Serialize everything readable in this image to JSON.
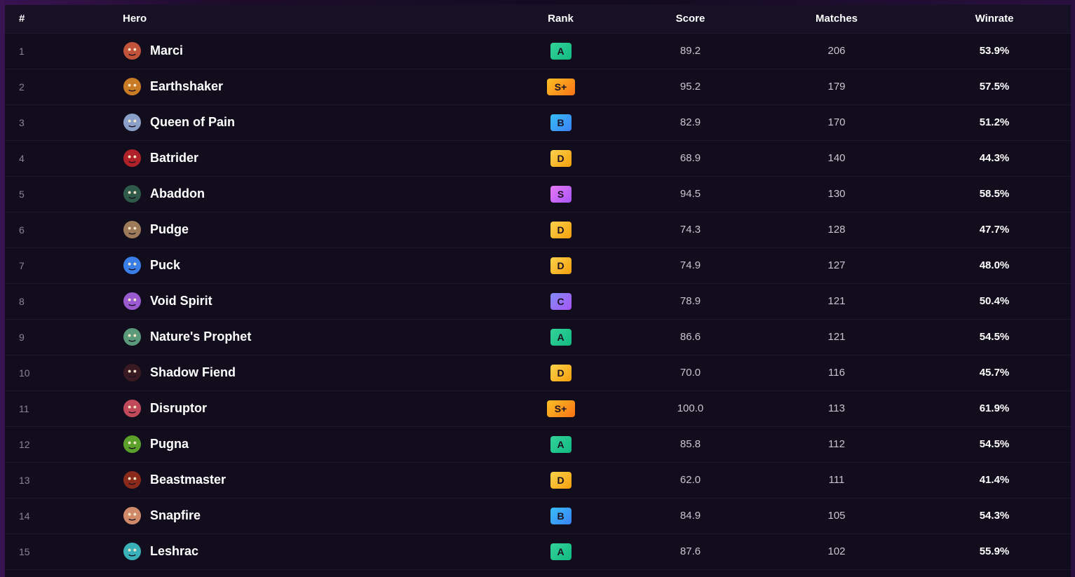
{
  "headers": {
    "num": "#",
    "hero": "Hero",
    "rank": "Rank",
    "score": "Score",
    "matches": "Matches",
    "winrate": "Winrate"
  },
  "rank_colors": {
    "A": "#10b981",
    "S+": "#f59e0b",
    "B": "#3b82f6",
    "C": "#a855f7",
    "D": "#fbbf24",
    "S": "#d946ef"
  },
  "rows": [
    {
      "num": "1",
      "hero": "Marci",
      "icon": "marci-portrait-icon",
      "icon_color": "#c0533a",
      "rank": "A",
      "score": "89.2",
      "matches": "206",
      "winrate": "53.9%"
    },
    {
      "num": "2",
      "hero": "Earthshaker",
      "icon": "earthshaker-portrait-icon",
      "icon_color": "#c97a25",
      "rank": "S+",
      "score": "95.2",
      "matches": "179",
      "winrate": "57.5%"
    },
    {
      "num": "3",
      "hero": "Queen of Pain",
      "icon": "queen-of-pain-portrait-icon",
      "icon_color": "#8aa0c8",
      "rank": "B",
      "score": "82.9",
      "matches": "170",
      "winrate": "51.2%"
    },
    {
      "num": "4",
      "hero": "Batrider",
      "icon": "batrider-portrait-icon",
      "icon_color": "#b0222a",
      "rank": "D",
      "score": "68.9",
      "matches": "140",
      "winrate": "44.3%"
    },
    {
      "num": "5",
      "hero": "Abaddon",
      "icon": "abaddon-portrait-icon",
      "icon_color": "#2f5a4a",
      "rank": "S",
      "score": "94.5",
      "matches": "130",
      "winrate": "58.5%"
    },
    {
      "num": "6",
      "hero": "Pudge",
      "icon": "pudge-portrait-icon",
      "icon_color": "#9c7a5a",
      "rank": "D",
      "score": "74.3",
      "matches": "128",
      "winrate": "47.7%"
    },
    {
      "num": "7",
      "hero": "Puck",
      "icon": "puck-portrait-icon",
      "icon_color": "#3a7ee8",
      "rank": "D",
      "score": "74.9",
      "matches": "127",
      "winrate": "48.0%"
    },
    {
      "num": "8",
      "hero": "Void Spirit",
      "icon": "void-spirit-portrait-icon",
      "icon_color": "#9a5ad0",
      "rank": "C",
      "score": "78.9",
      "matches": "121",
      "winrate": "50.4%"
    },
    {
      "num": "9",
      "hero": "Nature's Prophet",
      "icon": "natures-prophet-portrait-icon",
      "icon_color": "#5a9a7a",
      "rank": "A",
      "score": "86.6",
      "matches": "121",
      "winrate": "54.5%"
    },
    {
      "num": "10",
      "hero": "Shadow Fiend",
      "icon": "shadow-fiend-portrait-icon",
      "icon_color": "#3a1a22",
      "rank": "D",
      "score": "70.0",
      "matches": "116",
      "winrate": "45.7%"
    },
    {
      "num": "11",
      "hero": "Disruptor",
      "icon": "disruptor-portrait-icon",
      "icon_color": "#c04a5a",
      "rank": "S+",
      "score": "100.0",
      "matches": "113",
      "winrate": "61.9%"
    },
    {
      "num": "12",
      "hero": "Pugna",
      "icon": "pugna-portrait-icon",
      "icon_color": "#5aa02a",
      "rank": "A",
      "score": "85.8",
      "matches": "112",
      "winrate": "54.5%"
    },
    {
      "num": "13",
      "hero": "Beastmaster",
      "icon": "beastmaster-portrait-icon",
      "icon_color": "#8a2a1a",
      "rank": "D",
      "score": "62.0",
      "matches": "111",
      "winrate": "41.4%"
    },
    {
      "num": "14",
      "hero": "Snapfire",
      "icon": "snapfire-portrait-icon",
      "icon_color": "#d08a6a",
      "rank": "B",
      "score": "84.9",
      "matches": "105",
      "winrate": "54.3%"
    },
    {
      "num": "15",
      "hero": "Leshrac",
      "icon": "leshrac-portrait-icon",
      "icon_color": "#3ab0b8",
      "rank": "A",
      "score": "87.6",
      "matches": "102",
      "winrate": "55.9%"
    }
  ]
}
